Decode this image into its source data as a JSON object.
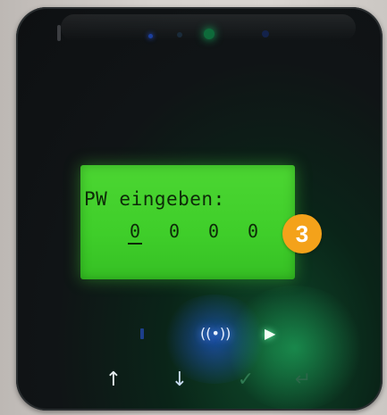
{
  "display": {
    "prompt": "PW eingeben:",
    "digits": [
      "0",
      "0",
      "0",
      "0"
    ]
  },
  "annotation": {
    "step": "3",
    "color": "#f4a21a"
  },
  "indicators": {
    "alert": "!",
    "wireless": "((•))",
    "play": "▶"
  },
  "buttons": {
    "up": "↑",
    "down": "↓",
    "ok": "✓",
    "enter": "↵"
  },
  "colors": {
    "lcd_background": "#3fce2a",
    "lcd_text": "#0d2a08",
    "device_body": "#101416"
  }
}
